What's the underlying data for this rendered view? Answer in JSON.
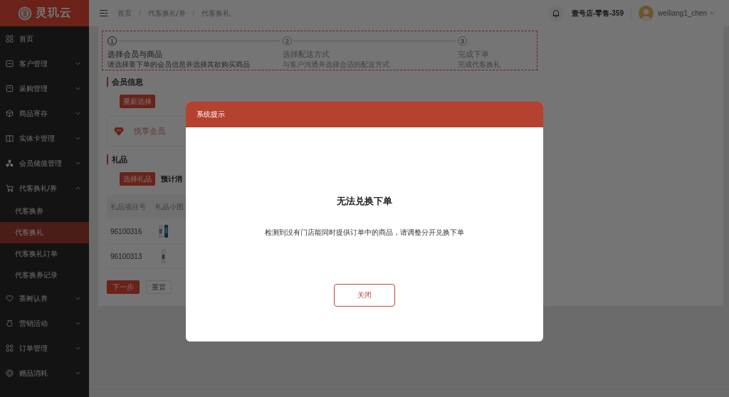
{
  "sidebar": {
    "logo": "灵玑云",
    "items": [
      {
        "kind": "link",
        "label": "首页",
        "selected": false
      },
      {
        "kind": "group",
        "label": "客户管理",
        "selected": false,
        "expanded": false
      },
      {
        "kind": "group",
        "label": "采购管理",
        "selected": false,
        "expanded": false
      },
      {
        "kind": "group",
        "label": "商品寄存",
        "selected": false,
        "expanded": false
      },
      {
        "kind": "group",
        "label": "实体卡管理",
        "selected": false,
        "expanded": false
      },
      {
        "kind": "group",
        "label": "会员储值管理",
        "selected": false,
        "expanded": false
      },
      {
        "kind": "group",
        "label": "代客换礼/券",
        "selected": false,
        "expanded": true,
        "children": [
          {
            "label": "代客换券",
            "selected": false
          },
          {
            "label": "代客换礼",
            "selected": true
          },
          {
            "label": "代客换礼订单",
            "selected": false
          },
          {
            "label": "代客换券记录",
            "selected": false
          }
        ]
      },
      {
        "kind": "group",
        "label": "茶树认养",
        "selected": false,
        "expanded": false
      },
      {
        "kind": "group",
        "label": "营销活动",
        "selected": false,
        "expanded": false
      },
      {
        "kind": "group",
        "label": "订单管理",
        "selected": false,
        "expanded": false
      },
      {
        "kind": "group",
        "label": "赠品消耗",
        "selected": false,
        "expanded": false
      }
    ]
  },
  "header": {
    "breadcrumbs": [
      {
        "label": "首页",
        "separator": "/"
      },
      {
        "label": "代客换礼/券",
        "separator": "/"
      },
      {
        "label": "代客换礼"
      }
    ],
    "store": "壹号店-零售-359",
    "user": "weiliang1_chen"
  },
  "steps": [
    {
      "number": "1",
      "title": "选择会员与商品",
      "description": "请选择要下单的会员信息并选择其欲购买商品",
      "active": true
    },
    {
      "number": "2",
      "title": "选择配送方式",
      "description": "与客户沟通并选择合适的配送方式",
      "active": false
    },
    {
      "number": "3",
      "title": "完成下单",
      "description": "完成代客换礼",
      "active": false
    }
  ],
  "member_section": {
    "title": "会员信息",
    "button": "重新选择",
    "member_level": "悦享会员"
  },
  "gift_section": {
    "title": "礼品",
    "button": "选择礼品",
    "estimate_label": "预计消",
    "table": {
      "columns": [
        "礼品项目号",
        "礼品小图"
      ],
      "rows": [
        {
          "item_no": "96100316"
        },
        {
          "item_no": "96100313"
        }
      ]
    }
  },
  "actions": [
    {
      "kind": "primary",
      "label": "下一步"
    },
    {
      "kind": "default",
      "label": "重置"
    }
  ],
  "dialog": {
    "title": "系统提示",
    "heading": "无法兑换下单",
    "message": "检测到没有门店能同时提供订单中的商品，请调整分开兑换下单",
    "button": "关闭"
  }
}
